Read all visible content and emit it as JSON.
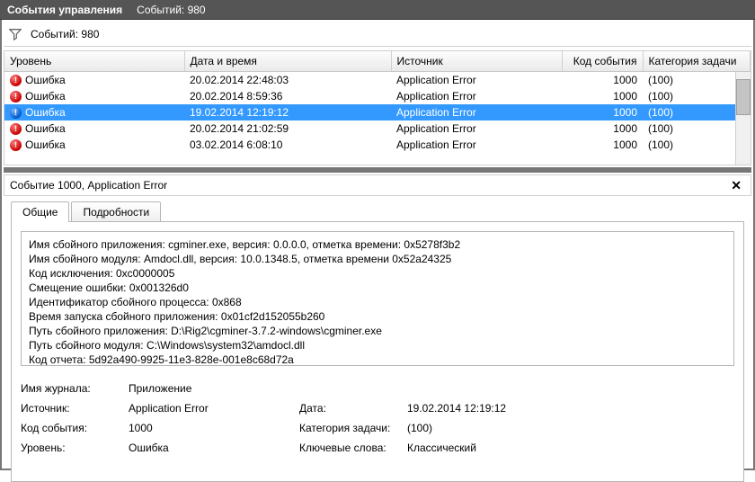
{
  "titlebar": {
    "title": "События управления",
    "count_label": "Событий: 980"
  },
  "filterbar": {
    "count_label": "Событий: 980"
  },
  "columns": {
    "level": "Уровень",
    "datetime": "Дата и время",
    "source": "Источник",
    "code": "Код события",
    "category": "Категория задачи"
  },
  "rows": [
    {
      "icon": "red",
      "level": "Ошибка",
      "datetime": "20.02.2014 22:48:03",
      "source": "Application Error",
      "code": "1000",
      "category": "(100)",
      "selected": false
    },
    {
      "icon": "red",
      "level": "Ошибка",
      "datetime": "20.02.2014 8:59:36",
      "source": "Application Error",
      "code": "1000",
      "category": "(100)",
      "selected": false
    },
    {
      "icon": "blue",
      "level": "Ошибка",
      "datetime": "19.02.2014 12:19:12",
      "source": "Application Error",
      "code": "1000",
      "category": "(100)",
      "selected": true
    },
    {
      "icon": "red",
      "level": "Ошибка",
      "datetime": "20.02.2014 21:02:59",
      "source": "Application Error",
      "code": "1000",
      "category": "(100)",
      "selected": false
    },
    {
      "icon": "red",
      "level": "Ошибка",
      "datetime": "03.02.2014 6:08:10",
      "source": "Application Error",
      "code": "1000",
      "category": "(100)",
      "selected": false
    }
  ],
  "detail": {
    "header": "Событие 1000, Application Error",
    "tabs": {
      "general": "Общие",
      "details": "Подробности"
    },
    "description_lines": [
      "Имя сбойного приложения: cgminer.exe, версия: 0.0.0.0, отметка времени: 0x5278f3b2",
      "Имя сбойного модуля: Amdocl.dll, версия: 10.0.1348.5, отметка времени 0x52a24325",
      "Код исключения: 0xc0000005",
      "Смещение ошибки: 0x001326d0",
      "Идентификатор сбойного процесса: 0x868",
      "Время запуска сбойного приложения: 0x01cf2d152055b260",
      "Путь сбойного приложения: D:\\Rig2\\cgminer-3.7.2-windows\\cgminer.exe",
      "Путь сбойного модуля: C:\\Windows\\system32\\amdocl.dll",
      "Код отчета: 5d92a490-9925-11e3-828e-001e8c68d72a"
    ],
    "meta": {
      "log_name_label": "Имя журнала:",
      "log_name_value": "Приложение",
      "source_label": "Источник:",
      "source_value": "Application Error",
      "date_label": "Дата:",
      "date_value": "19.02.2014 12:19:12",
      "code_label": "Код события:",
      "code_value": "1000",
      "cat_label": "Категория задачи:",
      "cat_value": "(100)",
      "level_label": "Уровень:",
      "level_value": "Ошибка",
      "kw_label": "Ключевые слова:",
      "kw_value": "Классический"
    }
  }
}
